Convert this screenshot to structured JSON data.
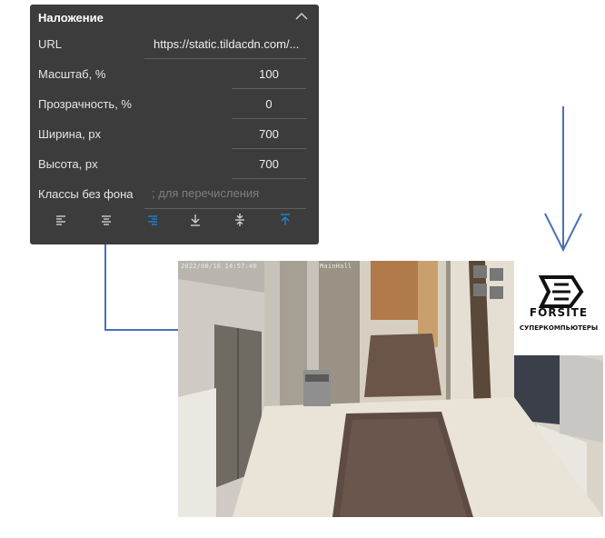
{
  "panel": {
    "title": "Наложение",
    "url_label": "URL",
    "url_value": "https://static.tildacdn.com/...",
    "scale_label": "Масштаб, %",
    "scale_value": "100",
    "opacity_label": "Прозрачность, %",
    "opacity_value": "0",
    "width_label": "Ширина, px",
    "width_value": "700",
    "height_label": "Высота, px",
    "height_value": "700",
    "classes_label": "Классы без фона",
    "classes_placeholder": "; для перечисления"
  },
  "toolbar": {
    "icons": [
      "align-left-icon",
      "align-center-icon",
      "align-right-icon",
      "align-bottom-icon",
      "align-middle-icon",
      "align-top-icon"
    ],
    "active_color": "#1e88e5",
    "icon_color": "#d8d8d8"
  },
  "camera": {
    "timestamp": "2022/08/16 14:57:40",
    "channel": "MainHall"
  },
  "logo": {
    "brand": "FORSITE",
    "subtitle": "СУПЕРКОМПЬЮТЕРЫ"
  },
  "colors": {
    "panel_bg": "#3c3c3c",
    "connector": "#4a6fb8"
  }
}
